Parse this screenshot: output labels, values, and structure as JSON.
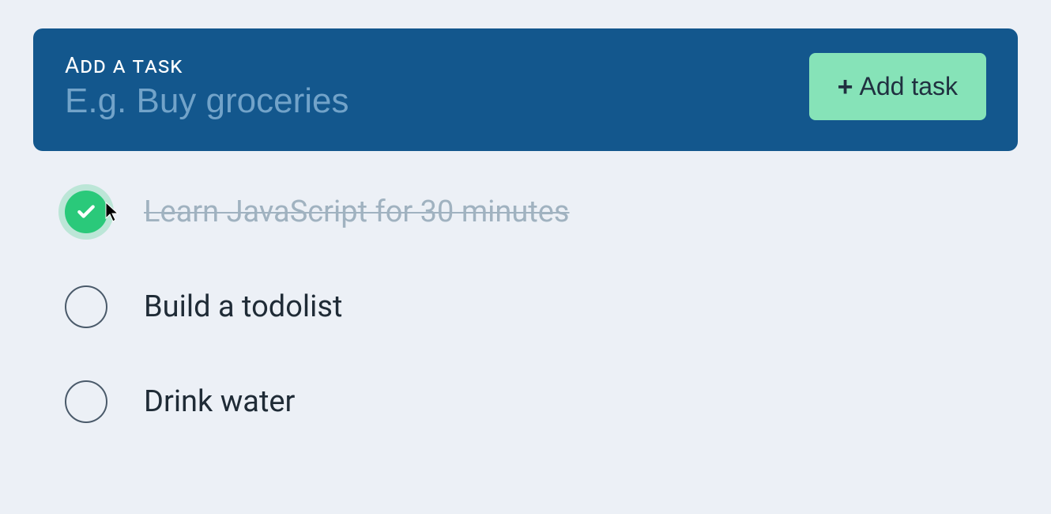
{
  "addTask": {
    "label": "Add a task",
    "placeholder": "E.g. Buy groceries",
    "value": "",
    "buttonLabel": "Add task"
  },
  "tasks": [
    {
      "text": "Learn JavaScript for 30 minutes",
      "completed": true
    },
    {
      "text": "Build a todolist",
      "completed": false
    },
    {
      "text": "Drink water",
      "completed": false
    }
  ]
}
